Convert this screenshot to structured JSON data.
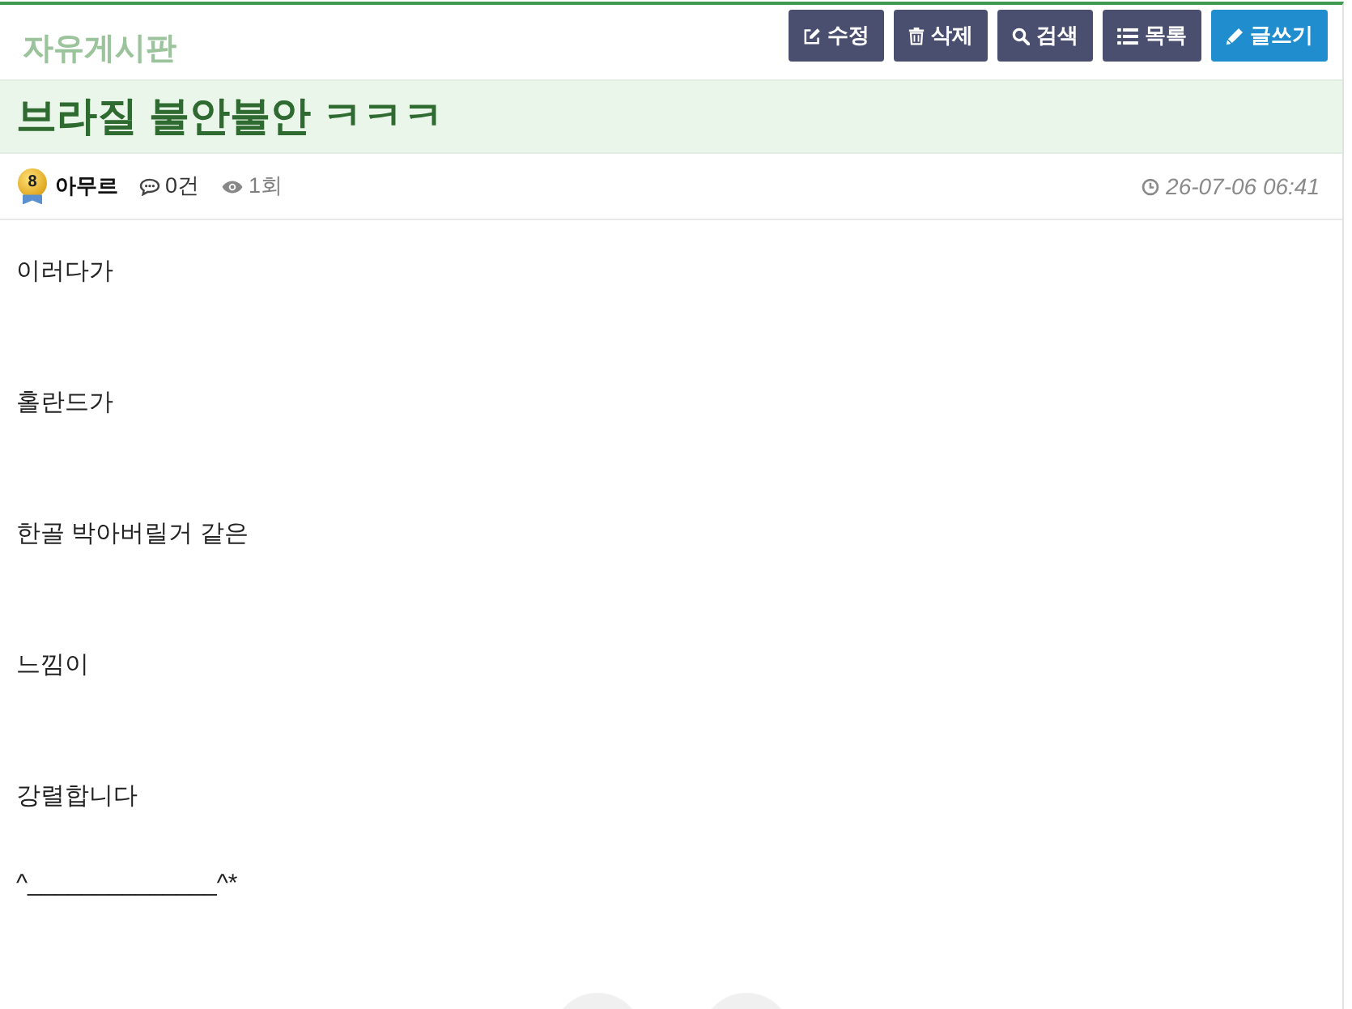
{
  "board": {
    "title": "자유게시판"
  },
  "toolbar": {
    "buttons": [
      {
        "kind": "edit",
        "label": "수정"
      },
      {
        "kind": "delete",
        "label": "삭제"
      },
      {
        "kind": "search",
        "label": "검색"
      },
      {
        "kind": "list",
        "label": "목록"
      },
      {
        "kind": "write",
        "label": "글쓰기"
      }
    ]
  },
  "post": {
    "title": "브라질 불안불안 ㅋㅋㅋ",
    "author": {
      "name": "아무르",
      "level": "8"
    },
    "comments": "0건",
    "views": "1회",
    "date": "26-07-06 06:41",
    "paragraphs": [
      "이러다가",
      "홀란드가",
      "한골 박아버릴거 같은",
      "느낌이",
      "강렬합니다",
      "^______________^*"
    ]
  }
}
